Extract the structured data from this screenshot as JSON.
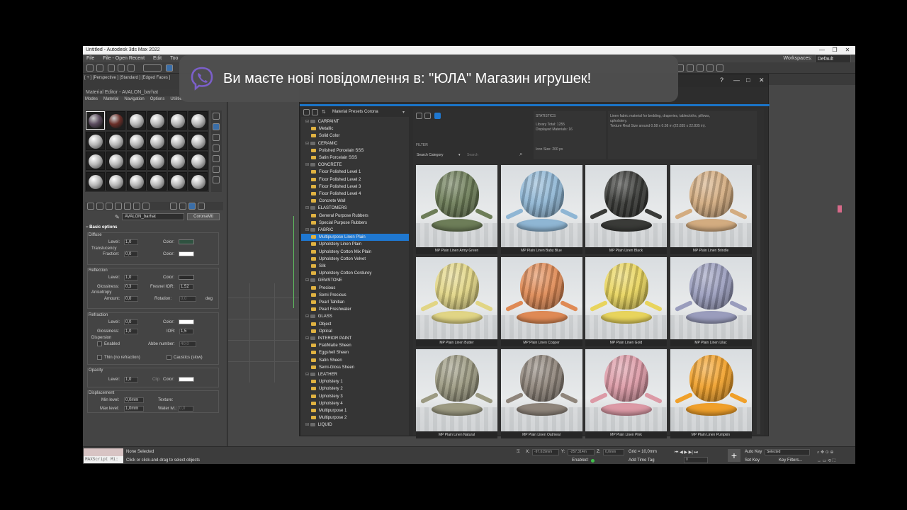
{
  "window": {
    "title": "Untitled - Autodesk 3ds Max 2022",
    "controls": [
      "—",
      "❐",
      "✕"
    ]
  },
  "menubar": {
    "items": [
      "File",
      "File - Open Recent",
      "Edit",
      "Too"
    ],
    "workspace_label": "Workspaces:",
    "workspace_value": "Default"
  },
  "viewport": {
    "label": "[ + ] [Perspective ] [Standard ] [Edged Faces ]"
  },
  "notification": {
    "text": "Ви маєте нові повідомлення в: \"ЮЛА\" Магазин игрушек!",
    "icon": "viber-icon"
  },
  "material_editor": {
    "title": "Material Editor - AVALON_barhat",
    "menu": [
      "Modes",
      "Material",
      "Navigation",
      "Options",
      "Utilities"
    ],
    "material_name": "AVALON_barhat",
    "material_type": "CoronaMtl",
    "rollout_title": "Basic options",
    "diffuse": {
      "title": "Diffuse",
      "level_label": "Level:",
      "level": "1,0",
      "color_label": "Color:",
      "translucency": "Translucency",
      "fraction_label": "Fraction:",
      "fraction": "0,0",
      "color2_label": "Color:"
    },
    "reflection": {
      "title": "Reflection",
      "level_label": "Level:",
      "level": "1,0",
      "color_label": "Color:",
      "gloss_label": "Glossiness:",
      "gloss": "0,3",
      "fresnel_label": "Fresnel IOR:",
      "fresnel": "1,52",
      "aniso_title": "Anisotropy",
      "amount_label": "Amount:",
      "amount": "0,0",
      "rotation_label": "Rotation:",
      "rotation": "0,0",
      "deg": "deg"
    },
    "refraction": {
      "title": "Refraction",
      "level_label": "Level:",
      "level": "0,0",
      "color_label": "Color:",
      "gloss_label": "Glossiness:",
      "gloss": "1,0",
      "ior_label": "IOR:",
      "ior": "1,5",
      "dispersion": "Dispersion",
      "enabled": "Enabled",
      "abbe_label": "Abbe number:",
      "abbe": "40,0",
      "thin": "Thin (no refraction)",
      "caustics": "Caustics (slow)"
    },
    "opacity": {
      "title": "Opacity",
      "level_label": "Level:",
      "level": "1,0",
      "clip": "Clip",
      "color_label": "Color:"
    },
    "displacement": {
      "title": "Displacement",
      "min_label": "Min level:",
      "min": "0,0mm",
      "texture_label": "Texture:",
      "max_label": "Max level:",
      "max": "1,0mm",
      "water_label": "Water lvl.:",
      "water": "0,0"
    },
    "slot_colors": [
      "#5a4a5e",
      "#6a2e28"
    ]
  },
  "presets": {
    "source": "Material Presets Corona",
    "statistics_title": "STATISTICS",
    "library_total": "Library Total: 1255",
    "displayed": "Displayed Materials: 16",
    "icon_size": "Icon Size: 200 px",
    "description": [
      "Linen fabric material for bedding, draperies, tablecloths, pillows,",
      "upholstery.",
      "Texture Real Size around 0.58 x 0.58 m (22.835 x 22.835 in)."
    ],
    "filter_title": "FILTER",
    "search_category": "Search Category",
    "search_placeholder": "Search",
    "tree": [
      {
        "label": "CARPAINT",
        "cat": true
      },
      {
        "label": "Metallic"
      },
      {
        "label": "Solid Color"
      },
      {
        "label": "CERAMIC",
        "cat": true
      },
      {
        "label": "Polished Porcelain SSS"
      },
      {
        "label": "Satin Porcelain SSS"
      },
      {
        "label": "CONCRETE",
        "cat": true
      },
      {
        "label": "Floor Polished Level 1"
      },
      {
        "label": "Floor Polished Level 2"
      },
      {
        "label": "Floor Polished Level 3"
      },
      {
        "label": "Floor Polished Level 4"
      },
      {
        "label": "Concrete Wall"
      },
      {
        "label": "ELASTOMERS",
        "cat": true
      },
      {
        "label": "General Purpose Rubbers"
      },
      {
        "label": "Special Purpose Rubbers"
      },
      {
        "label": "FABRIC",
        "cat": true
      },
      {
        "label": "Multipurpose Linen Plain",
        "sel": true
      },
      {
        "label": "Upholstery Linen Plain"
      },
      {
        "label": "Upholstery Cotton Mix Plain"
      },
      {
        "label": "Upholstery Cotton Velvet"
      },
      {
        "label": "Silk"
      },
      {
        "label": "Upholstery Cotton Corduroy"
      },
      {
        "label": "GEMSTONE",
        "cat": true
      },
      {
        "label": "Precious"
      },
      {
        "label": "Semi Precious"
      },
      {
        "label": "Pearl Tahitian"
      },
      {
        "label": "Pearl Freshwater"
      },
      {
        "label": "GLASS",
        "cat": true
      },
      {
        "label": "Object"
      },
      {
        "label": "Optical"
      },
      {
        "label": "INTERIOR PAINT",
        "cat": true
      },
      {
        "label": "Flat/Matte Sheen"
      },
      {
        "label": "Eggshell Sheen"
      },
      {
        "label": "Satin Sheen"
      },
      {
        "label": "Semi-Gloss Sheen"
      },
      {
        "label": "LEATHER",
        "cat": true
      },
      {
        "label": "Upholstery 1"
      },
      {
        "label": "Upholstery 2"
      },
      {
        "label": "Upholstery 3"
      },
      {
        "label": "Upholstery 4"
      },
      {
        "label": "Multipurpose 1"
      },
      {
        "label": "Multipurpose 2"
      },
      {
        "label": "LIQUID",
        "cat": true
      }
    ],
    "materials": [
      {
        "name": "MP Plain Linen Army Green",
        "color": "#6d7d58"
      },
      {
        "name": "MP Plain Linen Baby Blue",
        "color": "#8fb6d4"
      },
      {
        "name": "MP Plain Linen Black",
        "color": "#3a3b38"
      },
      {
        "name": "MP Plain Linen Brindle",
        "color": "#d3ac80"
      },
      {
        "name": "MP Plain Linen Butter",
        "color": "#e1d585"
      },
      {
        "name": "MP Plain Linen Copper",
        "color": "#df8a55"
      },
      {
        "name": "MP Plain Linen Gold",
        "color": "#e8d45d"
      },
      {
        "name": "MP Plain Linen Lilac",
        "color": "#9a9dbd"
      },
      {
        "name": "MP Plain Linen Natural",
        "color": "#9c9a82"
      },
      {
        "name": "MP Plain Linen Oatmeal",
        "color": "#8f857b"
      },
      {
        "name": "MP Plain Linen Pink",
        "color": "#dc9aa6"
      },
      {
        "name": "MP Plain Linen Pumpkin",
        "color": "#f0a02a"
      }
    ]
  },
  "status": {
    "maxscript": "MAXScript Mi:",
    "selection": "None Selected",
    "hint": "Click or click-and-drag to select objects",
    "x_label": "X:",
    "x": "-97,619mm",
    "y_label": "Y:",
    "y": "-257,314m",
    "z_label": "Z:",
    "z": "0,0mm",
    "grid": "Grid = 10,0mm",
    "enabled": "Enabled:",
    "add_time_tag": "Add Time Tag",
    "auto_key": "Auto Key",
    "selected": "Selected",
    "set_key": "Set Key",
    "key_filters": "Key Filters...",
    "frame": "0"
  }
}
